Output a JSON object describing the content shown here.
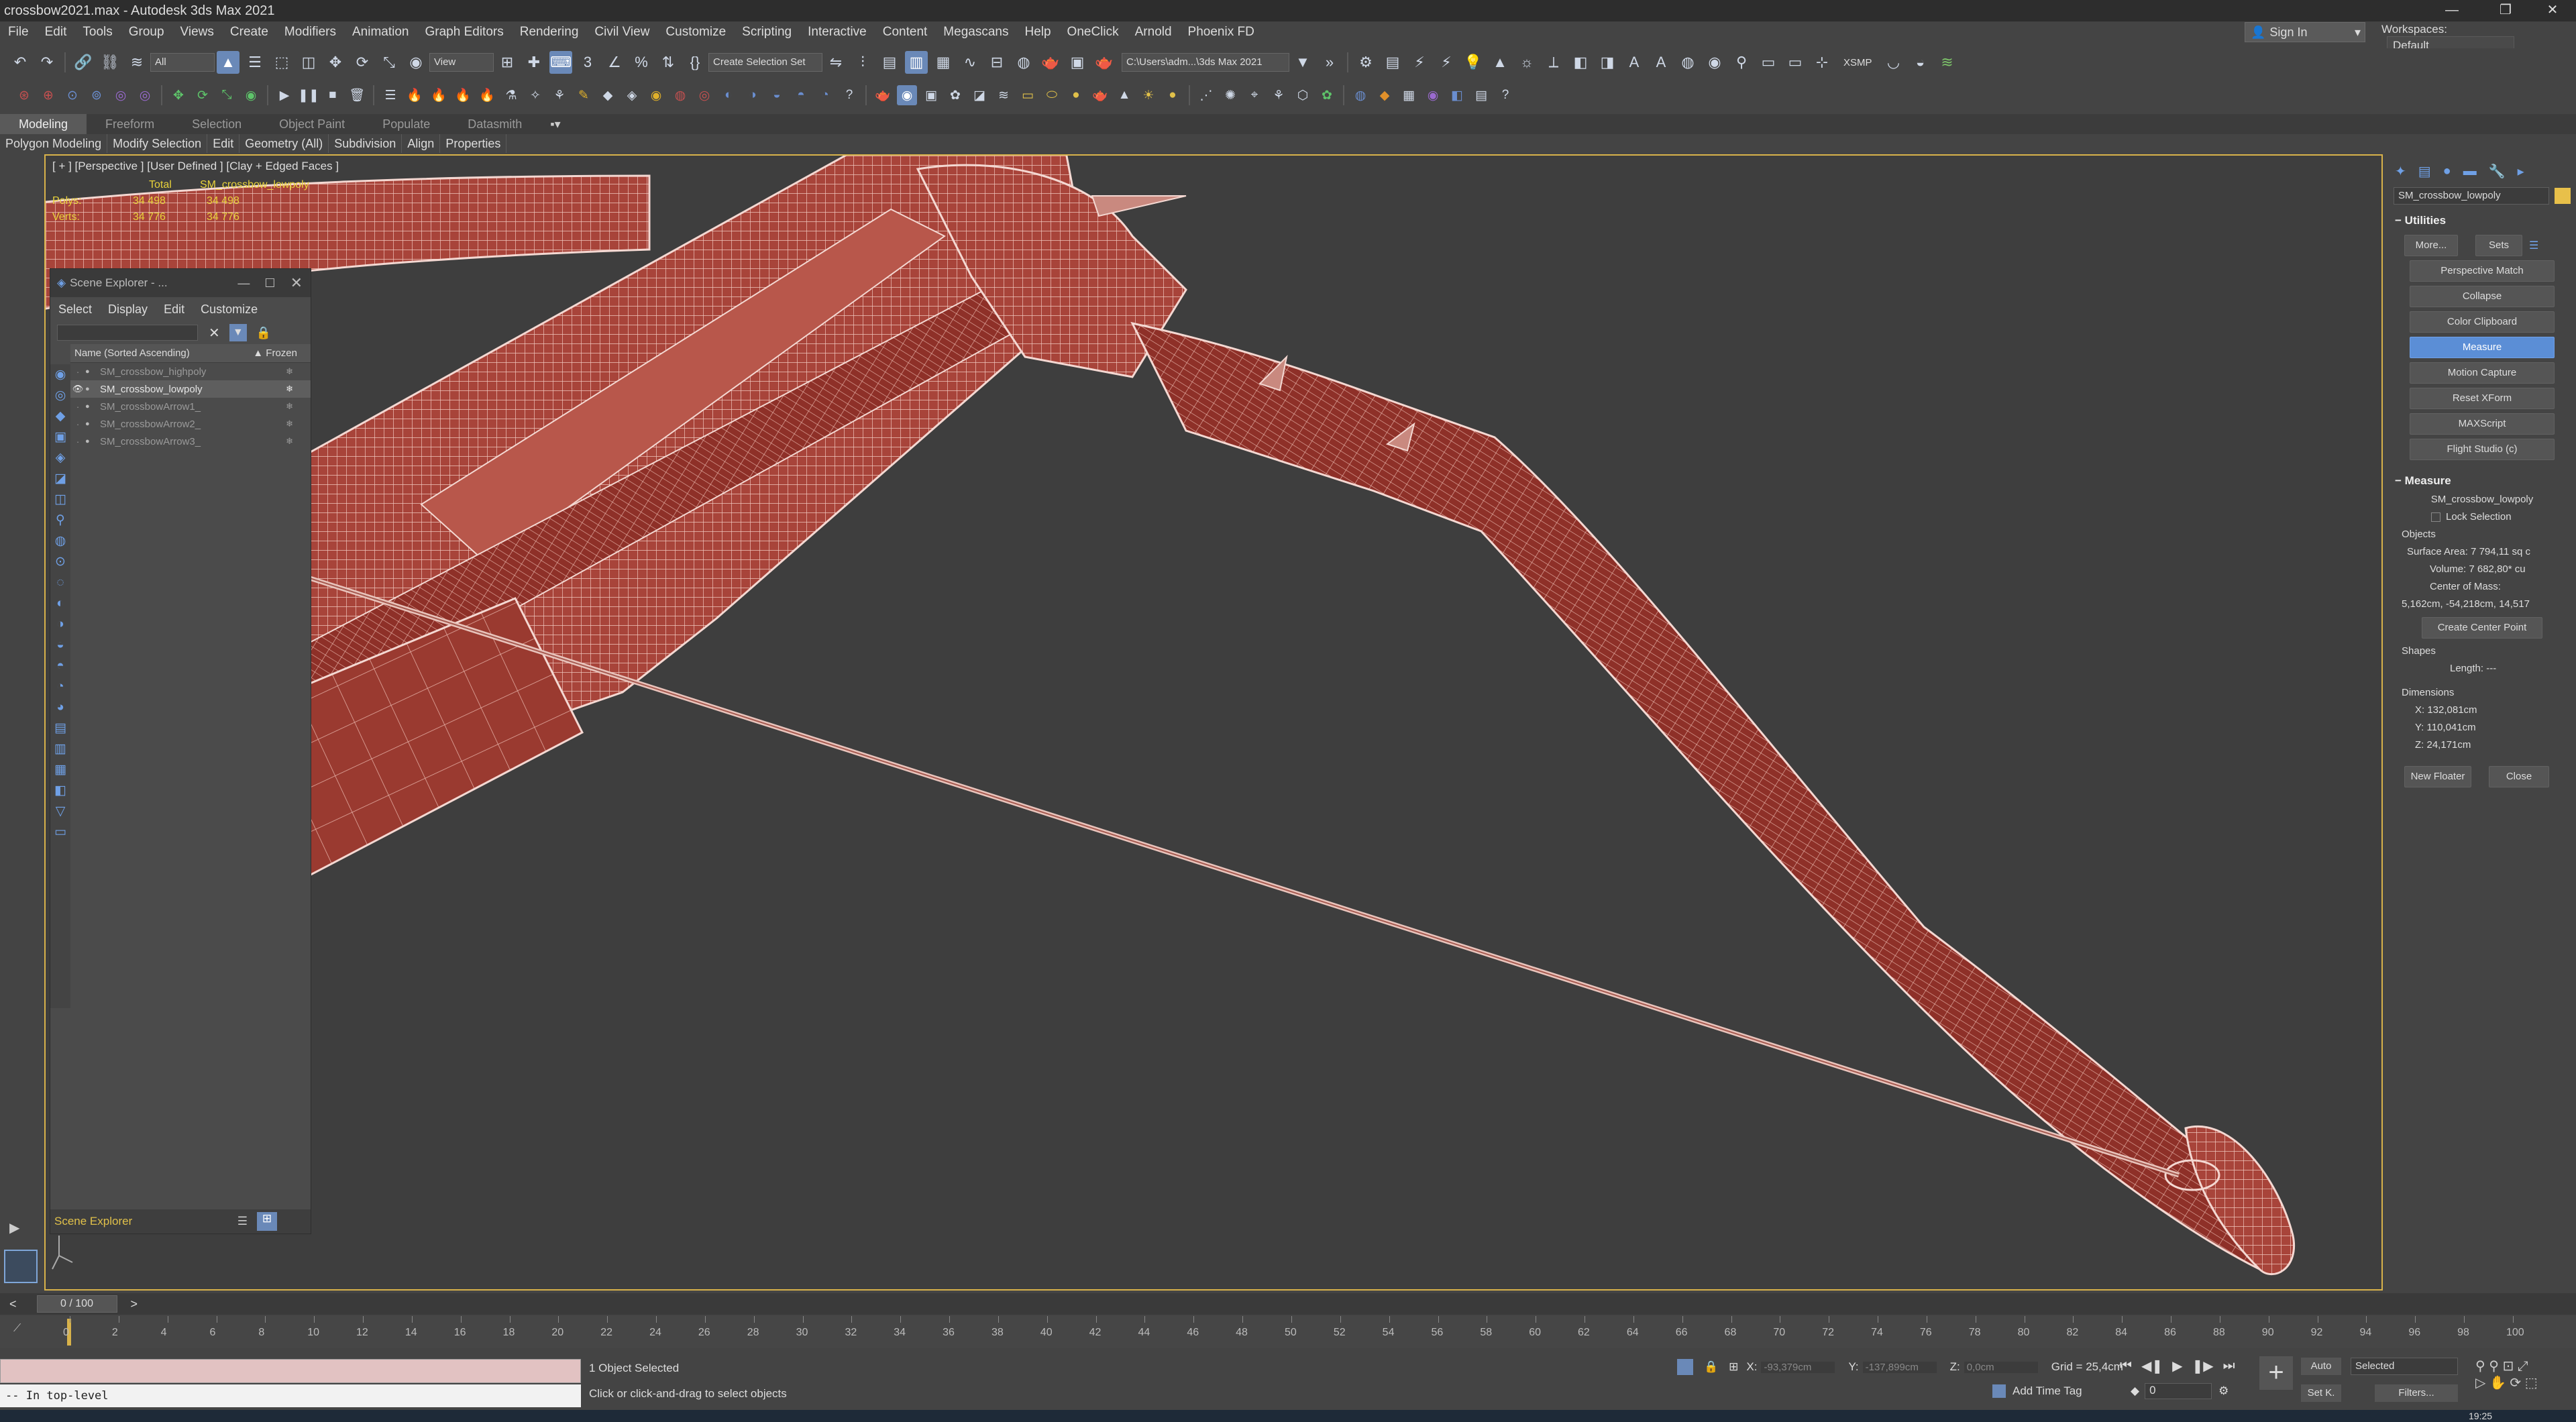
{
  "window": {
    "title": "crossbow2021.max - Autodesk 3ds Max 2021"
  },
  "menu": [
    "File",
    "Edit",
    "Tools",
    "Group",
    "Views",
    "Create",
    "Modifiers",
    "Animation",
    "Graph Editors",
    "Rendering",
    "Civil View",
    "Customize",
    "Scripting",
    "Interactive",
    "Content",
    "Megascans",
    "Help",
    "OneClick",
    "Arnold",
    "Phoenix FD"
  ],
  "account": {
    "sign_in": "Sign In",
    "workspaces_label": "Workspaces:",
    "workspace": "Default"
  },
  "toolbar": {
    "selection_filter": "All",
    "ref_coord": "View",
    "selection_set": "Create Selection Set",
    "project_path": "C:\\Users\\adm...\\3ds Max 2021",
    "xsmp": "XSMP"
  },
  "ribbon": {
    "tabs": [
      "Modeling",
      "Freeform",
      "Selection",
      "Object Paint",
      "Populate",
      "Datasmith"
    ],
    "subtabs": [
      "Polygon Modeling",
      "Modify Selection",
      "Edit",
      "Geometry (All)",
      "Subdivision",
      "Align",
      "Properties"
    ]
  },
  "viewport": {
    "label": "[ + ] [Perspective ] [User Defined ] [Clay + Edged Faces ]",
    "stats": {
      "total_label": "Total",
      "object": "SM_crossbow_lowpoly",
      "polys_label": "Polys:",
      "polys_total": "34 498",
      "polys_obj": "34 498",
      "verts_label": "Verts:",
      "verts_total": "34 776",
      "verts_obj": "34 776"
    }
  },
  "scene_explorer": {
    "title": "Scene Explorer - ...",
    "menu": [
      "Select",
      "Display",
      "Edit",
      "Customize"
    ],
    "col_name": "Name (Sorted Ascending)",
    "col_frozen": "▲ Frozen",
    "items": [
      "SM_crossbow_highpoly",
      "SM_crossbow_lowpoly",
      "SM_crossbowArrow1_",
      "SM_crossbowArrow2_",
      "SM_crossbowArrow3_"
    ],
    "selected_index": 1,
    "footer": "Scene Explorer"
  },
  "command_panel": {
    "object_name": "SM_crossbow_lowpoly",
    "utilities_title": "Utilities",
    "more": "More...",
    "sets": "Sets",
    "buttons": [
      "Perspective Match",
      "Collapse",
      "Color Clipboard",
      "Measure",
      "Motion Capture",
      "Reset XForm",
      "MAXScript",
      "Flight Studio (c)"
    ],
    "active_button": "Measure",
    "measure_title": "Measure",
    "measure_object": "SM_crossbow_lowpoly",
    "lock_selection": "Lock Selection",
    "objects_label": "Objects",
    "surface_area": "Surface Area: 7 794,11 sq c",
    "volume": "Volume: 7 682,80* cu",
    "center_of_mass_label": "Center of Mass:",
    "center_of_mass": "5,162cm, -54,218cm, 14,517",
    "create_center": "Create Center Point",
    "shapes_label": "Shapes",
    "length": "Length: ---",
    "dimensions_label": "Dimensions",
    "dim_x": "X:  132,081cm",
    "dim_y": "Y:  110,041cm",
    "dim_z": "Z:  24,171cm",
    "new_floater": "New Floater",
    "close": "Close"
  },
  "timeline": {
    "frame": "0 / 100",
    "ticks": [
      "0",
      "2",
      "4",
      "6",
      "8",
      "10",
      "12",
      "14",
      "16",
      "18",
      "20",
      "22",
      "24",
      "26",
      "28",
      "30",
      "32",
      "34",
      "36",
      "38",
      "40",
      "42",
      "44",
      "46",
      "48",
      "50",
      "52",
      "54",
      "56",
      "58",
      "60",
      "62",
      "64",
      "66",
      "68",
      "70",
      "72",
      "74",
      "76",
      "78",
      "80",
      "82",
      "84",
      "86",
      "88",
      "90",
      "92",
      "94",
      "96",
      "98",
      "100"
    ]
  },
  "status": {
    "selected": "1 Object Selected",
    "prompt": "Click or click-and-drag to select objects",
    "maxscript": "-- In top-level",
    "x_label": "X:",
    "x": "-93,379cm",
    "y_label": "Y:",
    "y": "-137,899cm",
    "z_label": "Z:",
    "z": "0,0cm",
    "grid": "Grid = 25,4cm",
    "add_time_tag": "Add Time Tag",
    "auto": "Auto",
    "set_k": "Set K.",
    "selected_dd": "Selected",
    "filters": "Filters...",
    "frame_field": "0",
    "clock": "19:25"
  }
}
